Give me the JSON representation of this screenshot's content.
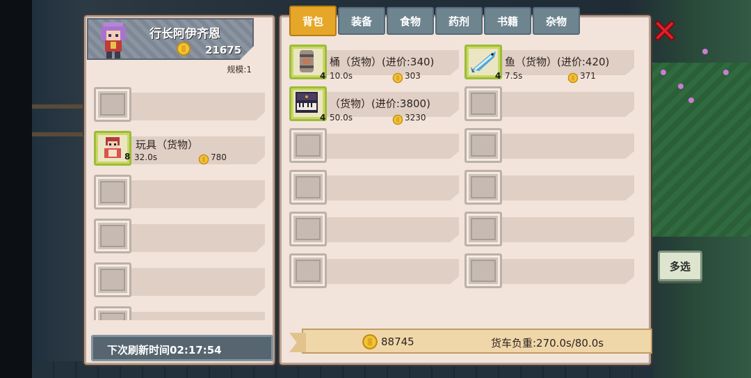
{
  "merchant": {
    "name": "行长阿伊齐恩",
    "gold": "21675",
    "scale": "规模:1"
  },
  "merchant_slots": [
    {
      "filled": false
    },
    {
      "filled": true,
      "icon": "toy-doll-icon",
      "count": "8",
      "name": "玩具（货物）",
      "weight": "32.0s",
      "price": "780"
    },
    {
      "filled": false
    },
    {
      "filled": false
    },
    {
      "filled": false
    },
    {
      "filled": false
    }
  ],
  "refresh": {
    "text": "下次刷新时间02:17:54"
  },
  "tabs": [
    {
      "label": "背包",
      "active": true
    },
    {
      "label": "装备",
      "active": false
    },
    {
      "label": "食物",
      "active": false
    },
    {
      "label": "药剂",
      "active": false
    },
    {
      "label": "书籍",
      "active": false
    },
    {
      "label": "杂物",
      "active": false
    }
  ],
  "inventory": [
    {
      "filled": true,
      "icon": "barrel-icon",
      "count": "4",
      "name": "桶（货物）(进价:340)",
      "weight": "10.0s",
      "price": "303"
    },
    {
      "filled": true,
      "icon": "fish-icon",
      "count": "4",
      "name": "鱼（货物）(进价:420)",
      "weight": "7.5s",
      "price": "371"
    },
    {
      "filled": true,
      "icon": "piano-icon",
      "count": "4",
      "name": "（货物）(进价:3800)",
      "weight": "50.0s",
      "price": "3230"
    },
    {
      "filled": false
    },
    {
      "filled": false
    },
    {
      "filled": false
    },
    {
      "filled": false
    },
    {
      "filled": false
    },
    {
      "filled": false
    },
    {
      "filled": false
    },
    {
      "filled": false
    },
    {
      "filled": false
    }
  ],
  "footer": {
    "gold": "88745",
    "load": "货车负重:270.0s/80.0s"
  },
  "buttons": {
    "multi_select": "多选"
  },
  "colors": {
    "panel": "#f2e4da",
    "tab_active": "#e6a627",
    "tab_inactive": "#6e8590",
    "slot_filled_border": "#9dbb3a",
    "close": "#e0202a"
  }
}
